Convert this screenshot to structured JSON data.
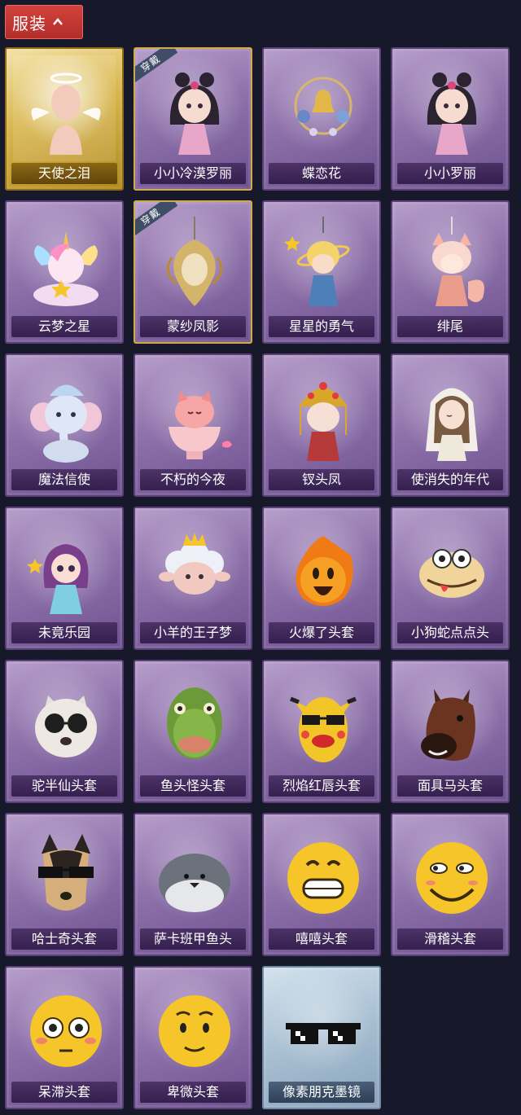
{
  "header": {
    "title": "服装",
    "toggle_icon": "chevron-up-icon"
  },
  "equipped_badge": "穿戴",
  "items": [
    {
      "name": "天使之泪",
      "frame": "gold",
      "icon": "angel-icon",
      "equipped": false
    },
    {
      "name": "小小冷漠罗丽",
      "frame": "purple",
      "icon": "doll-icon",
      "equipped": true
    },
    {
      "name": "蝶恋花",
      "frame": "purple",
      "icon": "bell-pendant-icon",
      "equipped": false
    },
    {
      "name": "小小罗丽",
      "frame": "purple",
      "icon": "doll-icon",
      "equipped": false
    },
    {
      "name": "云梦之星",
      "frame": "purple",
      "icon": "unicorn-icon",
      "equipped": false
    },
    {
      "name": "蒙纱凤影",
      "frame": "purple",
      "icon": "phoenix-pendant-icon",
      "equipped": true
    },
    {
      "name": "星星的勇气",
      "frame": "purple",
      "icon": "star-boy-icon",
      "equipped": false
    },
    {
      "name": "绯尾",
      "frame": "purple",
      "icon": "fox-girl-icon",
      "equipped": false
    },
    {
      "name": "魔法信使",
      "frame": "purple",
      "icon": "elephant-icon",
      "equipped": false
    },
    {
      "name": "不朽的今夜",
      "frame": "purple",
      "icon": "cat-cup-icon",
      "equipped": false
    },
    {
      "name": "钗头凤",
      "frame": "purple",
      "icon": "opera-doll-icon",
      "equipped": false
    },
    {
      "name": "使消失的年代",
      "frame": "purple",
      "icon": "veiled-doll-icon",
      "equipped": false
    },
    {
      "name": "未竟乐园",
      "frame": "purple",
      "icon": "fairy-doll-icon",
      "equipped": false
    },
    {
      "name": "小羊的王子梦",
      "frame": "purple",
      "icon": "sheep-icon",
      "equipped": false
    },
    {
      "name": "火爆了头套",
      "frame": "purple",
      "icon": "fire-head-icon",
      "equipped": false
    },
    {
      "name": "小狗蛇点点头",
      "frame": "purple",
      "icon": "snake-head-icon",
      "equipped": false
    },
    {
      "name": "驼半仙头套",
      "frame": "purple",
      "icon": "alpaca-sunglasses-icon",
      "equipped": false
    },
    {
      "name": "鱼头怪头套",
      "frame": "purple",
      "icon": "fish-head-icon",
      "equipped": false
    },
    {
      "name": "烈焰红唇头套",
      "frame": "purple",
      "icon": "pikachu-mask-icon",
      "equipped": false
    },
    {
      "name": "面具马头套",
      "frame": "purple",
      "icon": "horse-mask-icon",
      "equipped": false
    },
    {
      "name": "哈士奇头套",
      "frame": "purple",
      "icon": "husky-sunglasses-icon",
      "equipped": false
    },
    {
      "name": "萨卡班甲鱼头",
      "frame": "purple",
      "icon": "sacabambaspis-icon",
      "equipped": false
    },
    {
      "name": "嘻嘻头套",
      "frame": "purple",
      "icon": "grin-emoji-icon",
      "equipped": false
    },
    {
      "name": "滑稽头套",
      "frame": "purple",
      "icon": "funny-emoji-icon",
      "equipped": false
    },
    {
      "name": "呆滞头套",
      "frame": "purple",
      "icon": "flushed-emoji-icon",
      "equipped": false
    },
    {
      "name": "卑微头套",
      "frame": "purple",
      "icon": "pleading-emoji-icon",
      "equipped": false
    },
    {
      "name": "像素朋克墨镜",
      "frame": "blue",
      "icon": "pixel-sunglasses-icon",
      "equipped": false
    }
  ]
}
